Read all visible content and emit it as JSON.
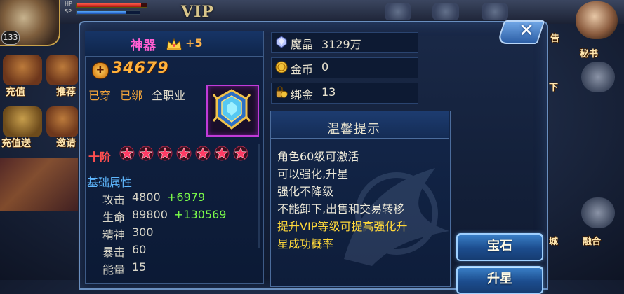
{
  "hud": {
    "level": "133",
    "hp_label": "HP",
    "sp_label": "SP",
    "vip_logo": "VIP",
    "left_buttons": [
      {
        "label": "充值",
        "icon": "gift-box-icon"
      },
      {
        "label": "推荐",
        "icon": "gift-box-icon"
      },
      {
        "label": "充值送",
        "icon": "chest-icon"
      },
      {
        "label": "邀请",
        "icon": "chest-icon"
      }
    ],
    "right_buttons": [
      {
        "label": "秘书",
        "icon": "secretary-avatar-icon"
      },
      {
        "label": "告",
        "icon": "notice-icon"
      },
      {
        "label": "下",
        "icon": "speaker-icon"
      },
      {
        "label": "城",
        "icon": "castle-icon"
      },
      {
        "label": "融合",
        "icon": "fusion-icon"
      }
    ]
  },
  "item": {
    "name": "神器",
    "enhance_level": "+5",
    "power_icon": "plus-circle-icon",
    "power": "34679",
    "status_worn": "已穿",
    "status_bound": "已绑",
    "class": "全职业",
    "gem_icon": "emblem-gem-icon",
    "tier_label": "十阶",
    "stars": 7,
    "star_color": "#ff3b64",
    "base_attr_title": "基础属性",
    "attributes": [
      {
        "name": "攻击",
        "base": "4800",
        "bonus": "+6979"
      },
      {
        "name": "生命",
        "base": "89800",
        "bonus": "+130569"
      },
      {
        "name": "精神",
        "base": "300",
        "bonus": ""
      },
      {
        "name": "暴击",
        "base": "60",
        "bonus": ""
      },
      {
        "name": "能量",
        "base": "15",
        "bonus": ""
      }
    ]
  },
  "currency": [
    {
      "icon": "crystal-icon",
      "label": "魔晶",
      "value": "3129万"
    },
    {
      "icon": "gold-coin-icon",
      "label": "金币",
      "value": "0"
    },
    {
      "icon": "bound-gold-icon",
      "label": "绑金",
      "value": "13"
    }
  ],
  "tip": {
    "title": "温馨提示",
    "lines": [
      {
        "text": "角色60级可激活",
        "style": "normal"
      },
      {
        "text": "可以强化,升星",
        "style": "normal"
      },
      {
        "text": "强化不降级",
        "style": "normal"
      },
      {
        "text": "不能卸下,出售和交易转移",
        "style": "normal"
      },
      {
        "text": "提升VIP等级可提高强化升",
        "style": "highlight"
      },
      {
        "text": "星成功概率",
        "style": "highlight"
      }
    ]
  },
  "actions": {
    "gem_button": "宝石",
    "upgrade_button": "升星"
  },
  "colors": {
    "item_name": "#ff5fd2",
    "power": "#ffb13b",
    "bonus": "#7dff4a",
    "section_title": "#5fb8ff",
    "tip_highlight": "#ffd83a"
  }
}
